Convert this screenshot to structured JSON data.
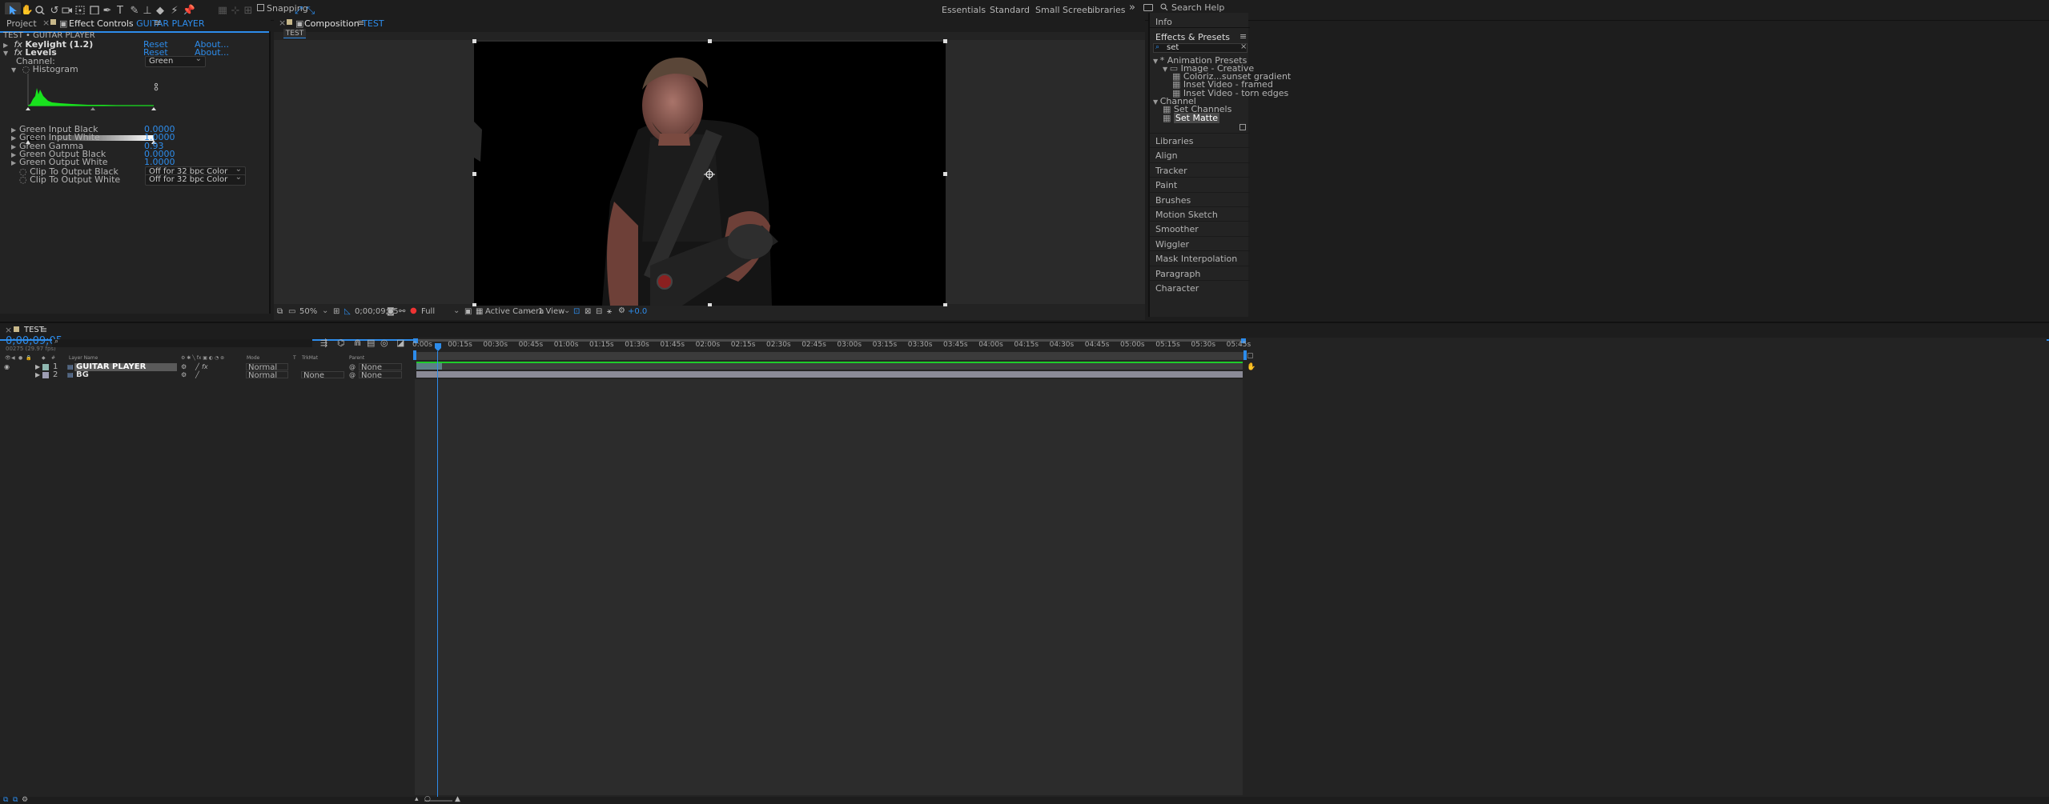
{
  "toolbar": {
    "snapping_label": "Snapping",
    "workspaces": [
      "Essentials",
      "Standard",
      "Small Screen",
      "Libraries"
    ],
    "more": "»",
    "search_placeholder": "Search Help"
  },
  "effect_controls": {
    "tab_project": "Project",
    "tab_effect_prefix": "Effect Controls",
    "tab_effect_layer": "GUITAR PLAYER",
    "breadcrumb": "TEST • GUITAR PLAYER",
    "effects": [
      {
        "name": "Keylight (1.2)",
        "reset": "Reset",
        "about": "About..."
      },
      {
        "name": "Levels",
        "reset": "Reset",
        "about": "About..."
      }
    ],
    "channel_label": "Channel:",
    "channel_value": "Green",
    "histogram_label": "Histogram",
    "properties": [
      {
        "label": "Green Input Black",
        "value": "0.0000"
      },
      {
        "label": "Green Input White",
        "value": "1.0000"
      },
      {
        "label": "Green Gamma",
        "value": "0.93"
      },
      {
        "label": "Green Output Black",
        "value": "0.0000"
      },
      {
        "label": "Green Output White",
        "value": "1.0000"
      }
    ],
    "clip_black_label": "Clip To Output Black",
    "clip_black_value": "Off for 32 bpc Color",
    "clip_white_label": "Clip To Output White",
    "clip_white_value": "Off for 32 bpc Color"
  },
  "composition": {
    "tab_prefix": "Composition",
    "tab_name": "TEST",
    "sub_tab": "TEST",
    "zoom": "50%",
    "timecode": "0;00;09;05",
    "resolution": "Full",
    "camera": "Active Camera",
    "views": "1 View",
    "exposure": "+0.0"
  },
  "right_panel": {
    "info": "Info",
    "effects_title": "Effects & Presets",
    "search_value": "set",
    "tree": [
      {
        "label": "* Animation Presets",
        "level": 0,
        "kind": "folder-open"
      },
      {
        "label": "Image - Creative",
        "level": 1,
        "kind": "folder"
      },
      {
        "label": "Coloriz...sunset gradient",
        "level": 2,
        "kind": "preset"
      },
      {
        "label": "Inset Video - framed",
        "level": 2,
        "kind": "preset"
      },
      {
        "label": "Inset Video - torn edges",
        "level": 2,
        "kind": "preset"
      },
      {
        "label": "Channel",
        "level": 0,
        "kind": "folder-open"
      },
      {
        "label": "Set Channels",
        "level": 1,
        "kind": "effect"
      },
      {
        "label": "Set Matte",
        "level": 1,
        "kind": "effect",
        "selected": true
      }
    ],
    "panels": [
      "Libraries",
      "Align",
      "Tracker",
      "Paint",
      "Brushes",
      "Motion Sketch",
      "Smoother",
      "Wiggler",
      "Mask Interpolation",
      "Paragraph",
      "Character"
    ]
  },
  "timeline": {
    "tab_name": "TEST",
    "timecode": "0;00;09;05",
    "frame_info": "00275 (29.97 fps)",
    "columns": {
      "layer_name": "Layer Name",
      "mode": "Mode",
      "t": "T",
      "trkmat": "TrkMat",
      "parent": "Parent",
      "num": "#"
    },
    "layers": [
      {
        "num": "1",
        "name": "GUITAR PLAYER",
        "mode": "Normal",
        "trkmat": "",
        "parent": "None",
        "selected": true
      },
      {
        "num": "2",
        "name": "BG",
        "mode": "Normal",
        "trkmat": "None",
        "parent": "None",
        "selected": false
      }
    ],
    "ruler": [
      "0:00s",
      "00:15s",
      "00:30s",
      "00:45s",
      "01:00s",
      "01:15s",
      "01:30s",
      "01:45s",
      "02:00s",
      "02:15s",
      "02:30s",
      "02:45s",
      "03:00s",
      "03:15s",
      "03:30s",
      "03:45s",
      "04:00s",
      "04:15s",
      "04:30s",
      "04:45s",
      "05:00s",
      "05:15s",
      "05:30s",
      "05:45s"
    ]
  },
  "colors": {
    "accent": "#2d8ceb",
    "layer1_bar": "#5c7f86",
    "layer2_bar": "#8a8a96",
    "histogram": "#19e21e",
    "work_area": "#6a6a6a"
  }
}
